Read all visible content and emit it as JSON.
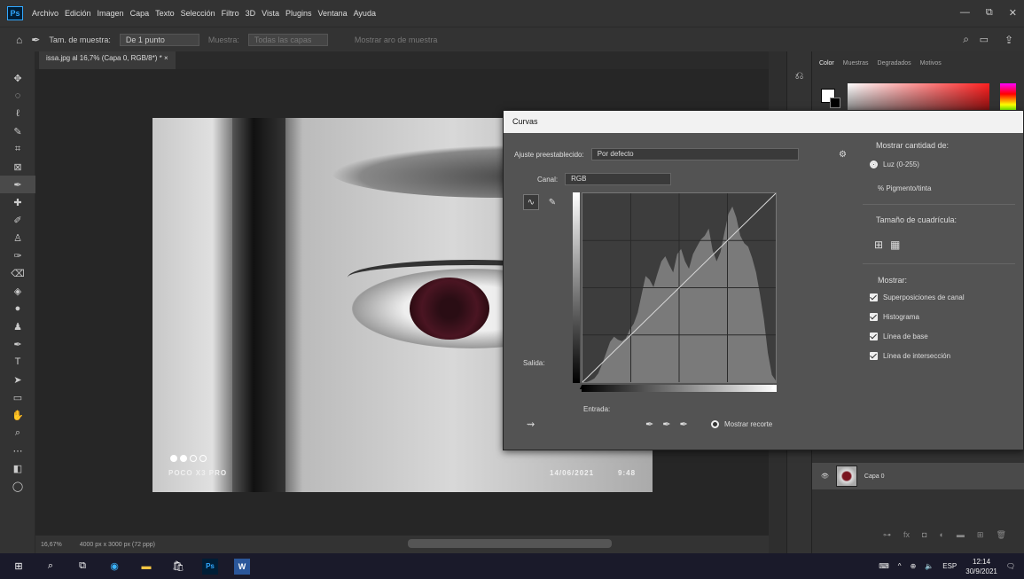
{
  "app": {
    "logo": "Ps",
    "menus": [
      "Archivo",
      "Edición",
      "Imagen",
      "Capa",
      "Texto",
      "Selección",
      "Filtro",
      "3D",
      "Vista",
      "Plugins",
      "Ventana",
      "Ayuda"
    ],
    "win_controls": [
      "—",
      "⧉",
      "✕"
    ]
  },
  "options_bar": {
    "sample_size_label": "Tam. de muestra:",
    "sample_size_value": "De 1 punto",
    "sample_label": "Muestra:",
    "sample_value": "Todas las capas",
    "ring_label": "Mostrar aro de muestra"
  },
  "document": {
    "tab_title": "issa.jpg al 16,7% (Capa 0, RGB/8*) *",
    "tab_close": "×",
    "photo_brand": "POCO X3 PRO",
    "photo_date": "14/06/2021",
    "photo_time": "9:48"
  },
  "status": {
    "zoom": "16,67%",
    "size": "4000 px x 3000 px (72 ppp)"
  },
  "right_panel": {
    "tabs": [
      "Color",
      "Muestras",
      "Degradados",
      "Motivos"
    ],
    "layer_name": "Capa 0"
  },
  "curves": {
    "title": "Curvas",
    "preset_label": "Ajuste preestablecido:",
    "preset_value": "Por defecto",
    "channel_label": "Canal:",
    "channel_value": "RGB",
    "output_label": "Salida:",
    "input_label": "Entrada:",
    "show_clipping": "Mostrar recorte",
    "show_amount_title": "Mostrar cantidad de:",
    "option_light": "Luz (0-255)",
    "option_pigment": "% Pigmento/tinta",
    "grid_size_title": "Tamaño de cuadrícula:",
    "show_title": "Mostrar:",
    "show_options": [
      "Superposiciones de canal",
      "Histograma",
      "Línea de base",
      "Línea de intersección"
    ],
    "histogram": [
      0,
      0,
      2,
      5,
      12,
      25,
      40,
      55,
      62,
      58,
      56,
      60,
      72,
      80,
      95,
      120,
      145,
      140,
      130,
      148,
      165,
      172,
      160,
      150,
      175,
      182,
      165,
      155,
      175,
      185,
      195,
      200,
      210,
      180,
      165,
      178,
      205,
      230,
      240,
      225,
      200,
      190,
      185,
      170,
      150,
      120,
      85,
      40,
      10,
      2
    ]
  },
  "taskbar": {
    "search": "⌕",
    "lang": "ESP",
    "time": "12:14",
    "date": "30/9/2021"
  }
}
